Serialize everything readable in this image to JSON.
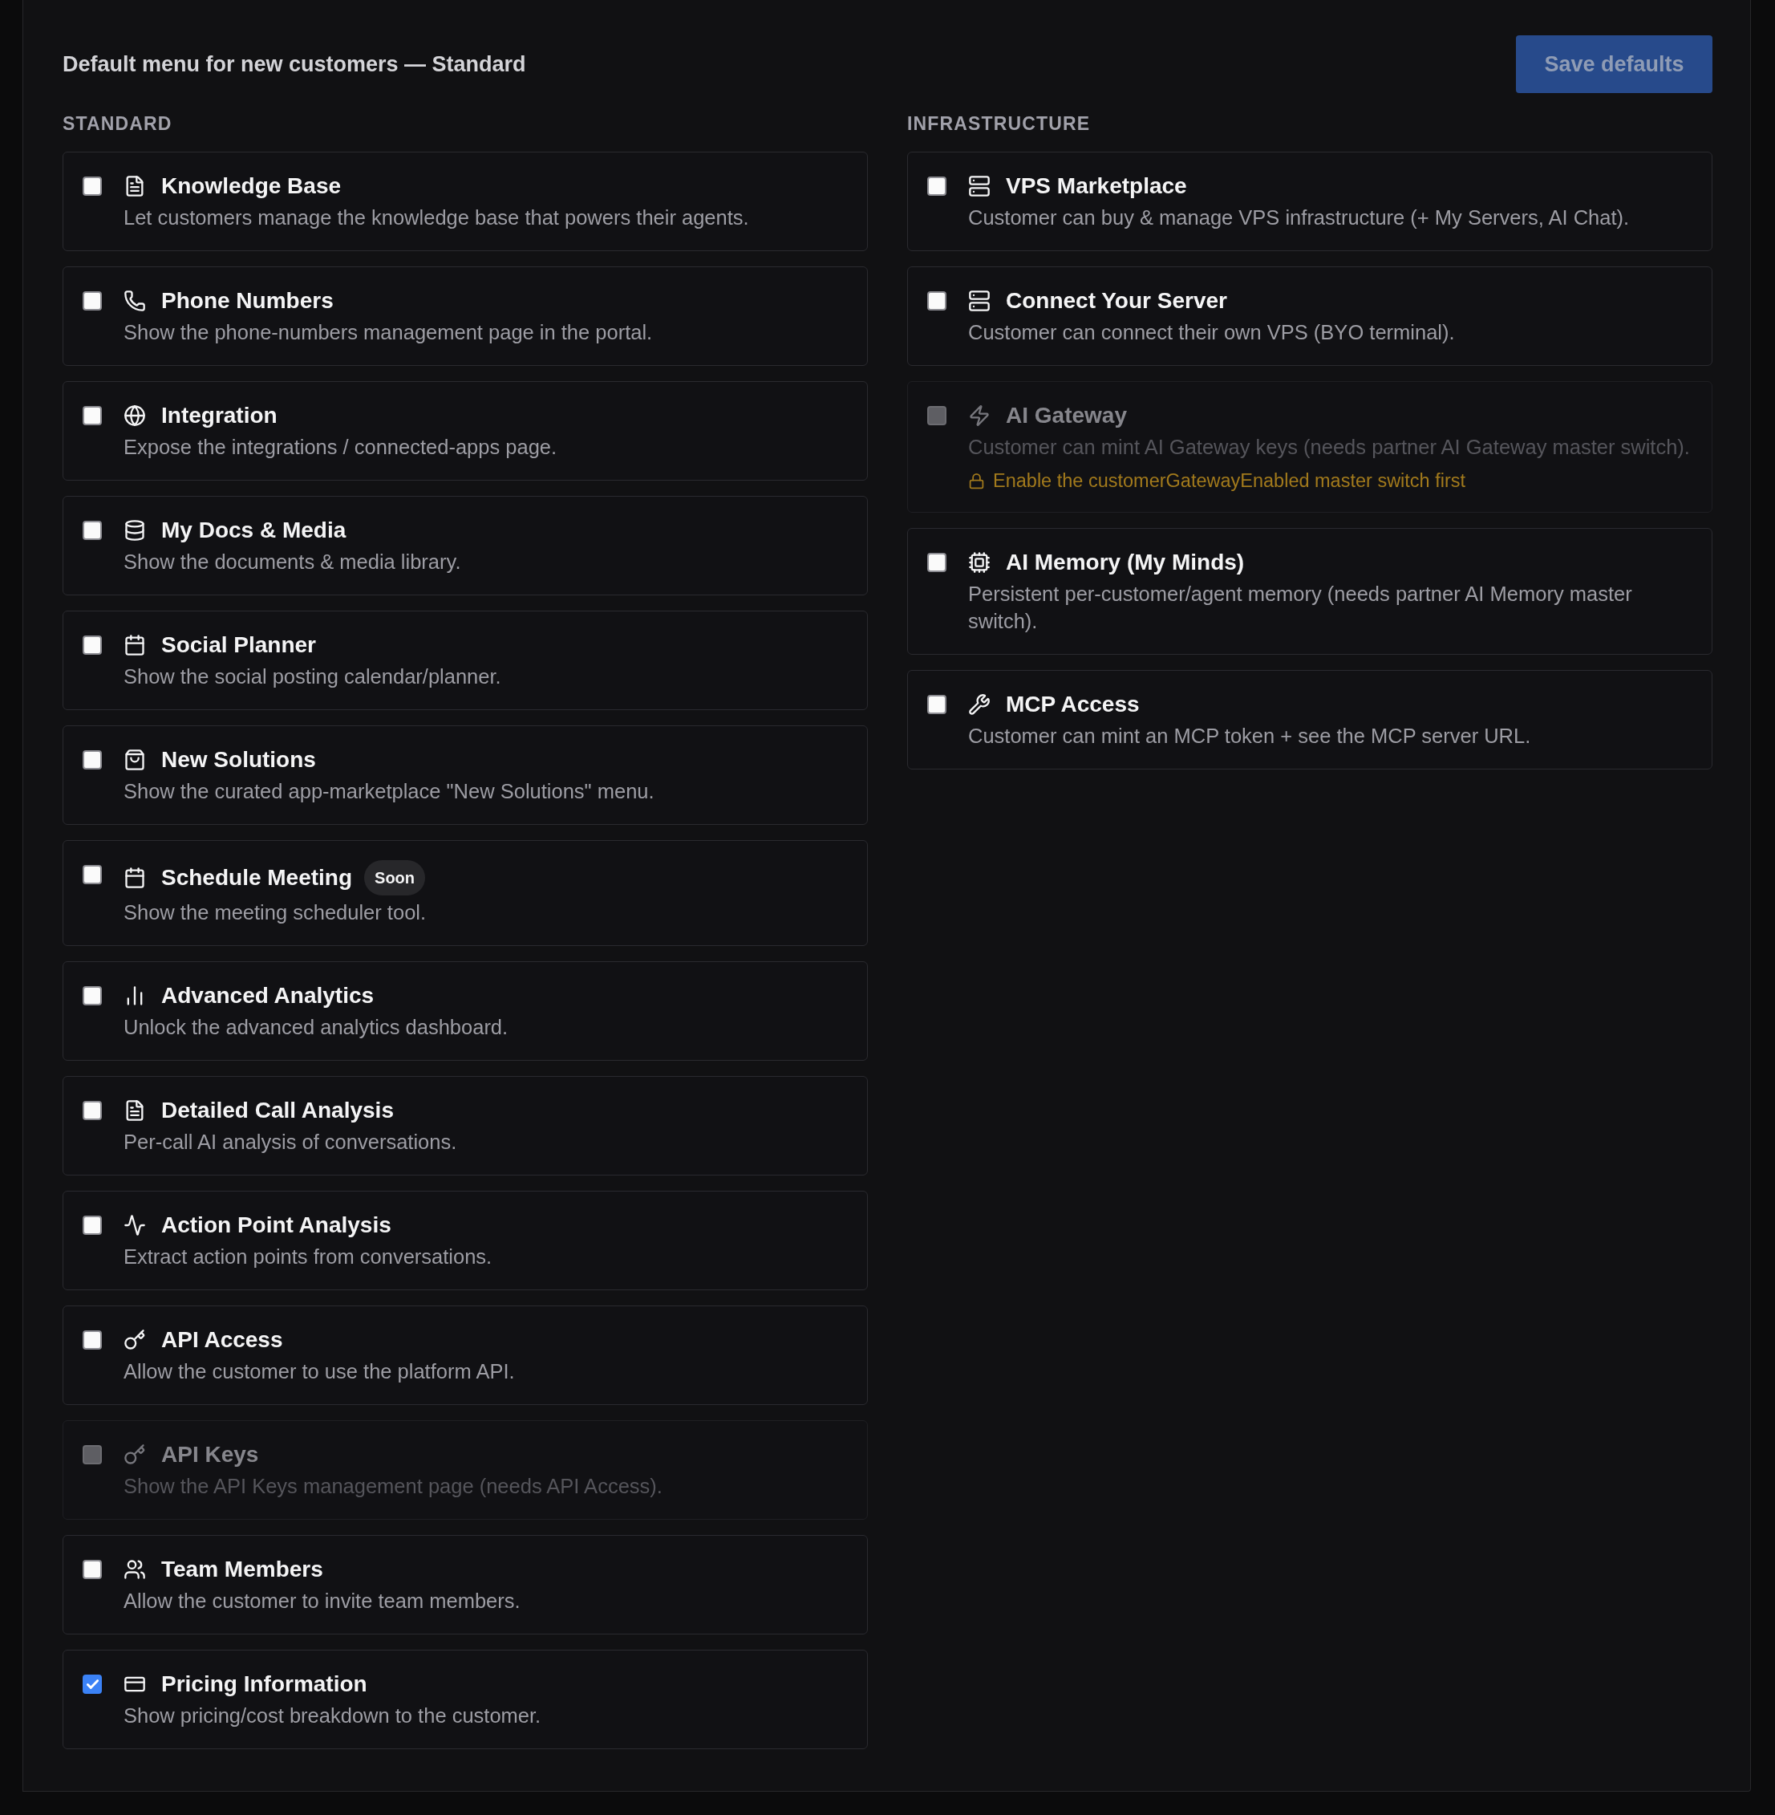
{
  "header": {
    "title": "Default menu for new customers — Standard",
    "save_button": {
      "label": "Save defaults",
      "disabled": true
    }
  },
  "sections": [
    {
      "label": "STANDARD",
      "items": [
        {
          "title": "Knowledge Base",
          "description": "Let customers manage the knowledge base that powers their agents.",
          "checked": false,
          "disabled": false
        },
        {
          "title": "Phone Numbers",
          "description": "Show the phone-numbers management page in the portal.",
          "checked": false,
          "disabled": false
        },
        {
          "title": "Integration",
          "description": "Expose the integrations / connected-apps page.",
          "checked": false,
          "disabled": false
        },
        {
          "title": "My Docs & Media",
          "description": "Show the documents & media library.",
          "checked": false,
          "disabled": false
        },
        {
          "title": "Social Planner",
          "description": "Show the social posting calendar/planner.",
          "checked": false,
          "disabled": false
        },
        {
          "title": "New Solutions",
          "description": "Show the curated app-marketplace \"New Solutions\" menu.",
          "checked": false,
          "disabled": false
        },
        {
          "title": "Schedule Meeting",
          "badge": "Soon",
          "description": "Show the meeting scheduler tool.",
          "checked": false,
          "disabled": false
        },
        {
          "title": "Advanced Analytics",
          "description": "Unlock the advanced analytics dashboard.",
          "checked": false,
          "disabled": false
        },
        {
          "title": "Detailed Call Analysis",
          "description": "Per-call AI analysis of conversations.",
          "checked": false,
          "disabled": false
        },
        {
          "title": "Action Point Analysis",
          "description": "Extract action points from conversations.",
          "checked": false,
          "disabled": false
        },
        {
          "title": "API Access",
          "description": "Allow the customer to use the platform API.",
          "checked": false,
          "disabled": false
        },
        {
          "title": "API Keys",
          "description": "Show the API Keys management page (needs API Access).",
          "checked": false,
          "disabled": true
        },
        {
          "title": "Team Members",
          "description": "Allow the customer to invite team members.",
          "checked": false,
          "disabled": false
        },
        {
          "title": "Pricing Information",
          "description": "Show pricing/cost breakdown to the customer.",
          "checked": true,
          "disabled": false
        }
      ]
    },
    {
      "label": "INFRASTRUCTURE",
      "items": [
        {
          "title": "VPS Marketplace",
          "description": "Customer can buy & manage VPS infrastructure (+ My Servers, AI Chat).",
          "checked": false,
          "disabled": false
        },
        {
          "title": "Connect Your Server",
          "description": "Customer can connect their own VPS (BYO terminal).",
          "checked": false,
          "disabled": false
        },
        {
          "title": "AI Gateway",
          "description": "Customer can mint AI Gateway keys (needs partner AI Gateway master switch).",
          "notice": "Enable the customerGatewayEnabled master switch first",
          "checked": false,
          "disabled": true
        },
        {
          "title": "AI Memory (My Minds)",
          "description": "Persistent per-customer/agent memory (needs partner AI Memory master switch).",
          "checked": false,
          "disabled": false
        },
        {
          "title": "MCP Access",
          "description": "Customer can mint an MCP token + see the MCP server URL.",
          "checked": false,
          "disabled": false
        }
      ]
    }
  ]
}
